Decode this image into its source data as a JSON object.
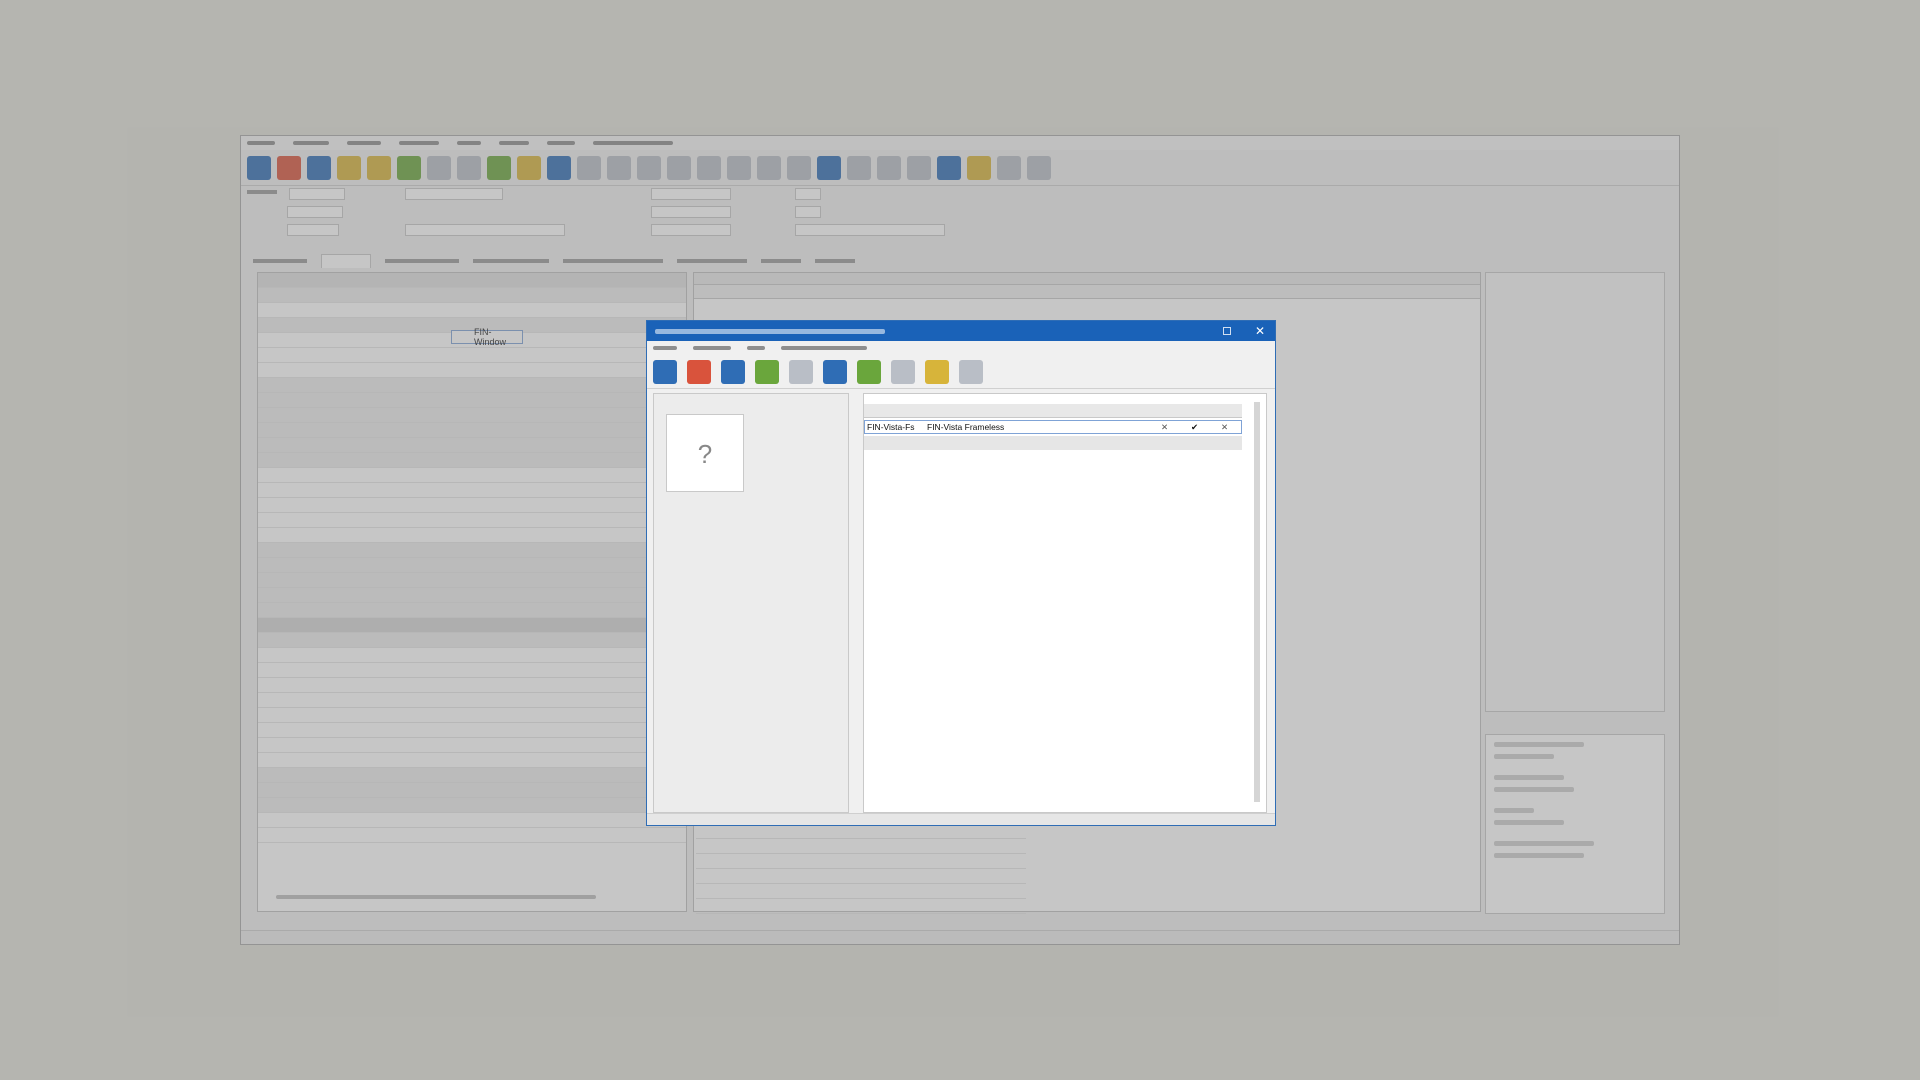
{
  "dialog": {
    "selected_row": {
      "system": "FIN-Vista-Fs",
      "description": "FIN-Vista Frameless",
      "col_x": "✕",
      "col_check": "✔",
      "col_x2": "✕"
    },
    "placeholder_glyph": "?"
  },
  "main_grid": {
    "system_value": "FIN-Window"
  },
  "colors": {
    "dialog_titlebar": "#1a62b8",
    "background": "#e1e1d8"
  }
}
